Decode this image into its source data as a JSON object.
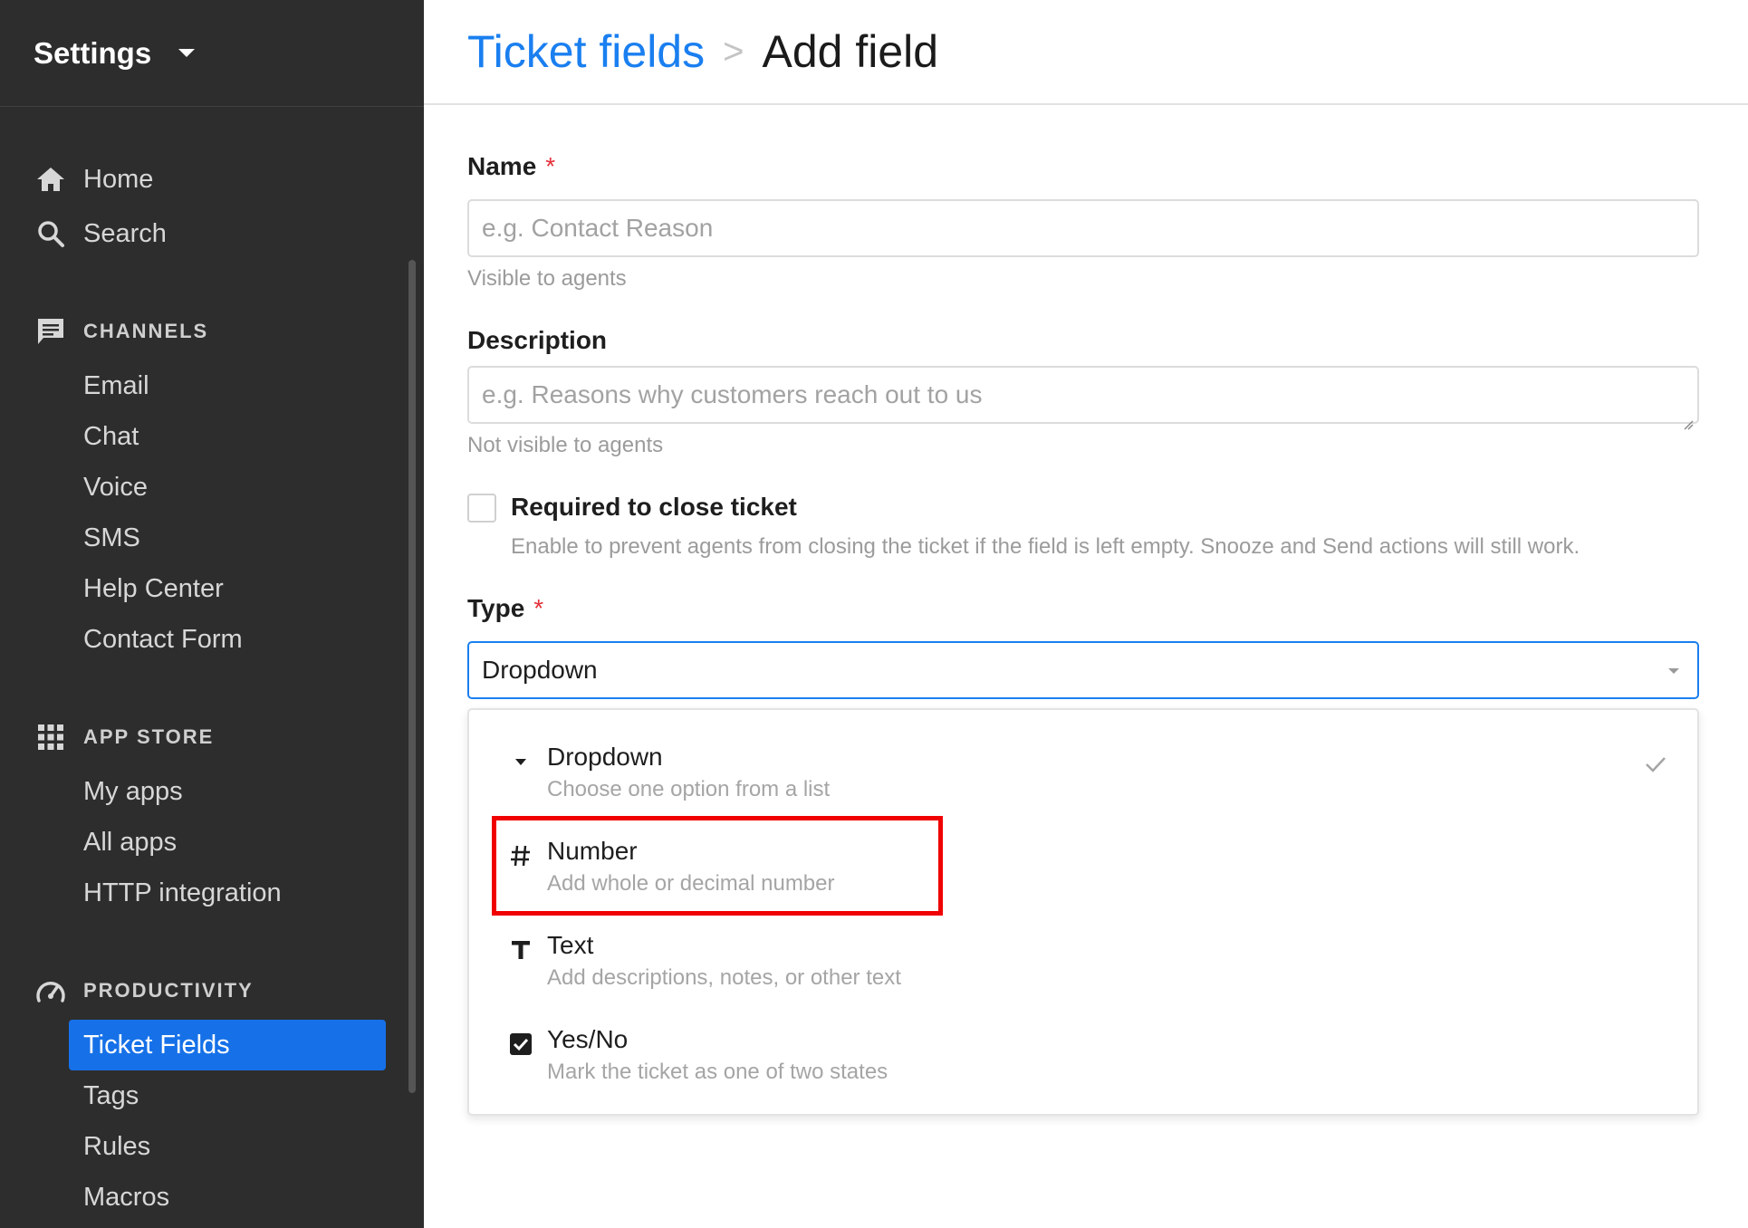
{
  "sidebar": {
    "title": "Settings",
    "top_items": [
      {
        "label": "Home",
        "icon": "home-icon"
      },
      {
        "label": "Search",
        "icon": "search-icon"
      }
    ],
    "sections": [
      {
        "title": "CHANNELS",
        "icon": "chat-bubble-icon",
        "items": [
          "Email",
          "Chat",
          "Voice",
          "SMS",
          "Help Center",
          "Contact Form"
        ]
      },
      {
        "title": "APP STORE",
        "icon": "apps-grid-icon",
        "items": [
          "My apps",
          "All apps",
          "HTTP integration"
        ]
      },
      {
        "title": "PRODUCTIVITY",
        "icon": "speedometer-icon",
        "items": [
          "Ticket Fields",
          "Tags",
          "Rules",
          "Macros"
        ]
      }
    ],
    "active_item": "Ticket Fields"
  },
  "header": {
    "breadcrumb_link": "Ticket fields",
    "separator": ">",
    "current": "Add field"
  },
  "form": {
    "name_label": "Name",
    "required_mark": "*",
    "name_placeholder": "e.g. Contact Reason",
    "name_help": "Visible to agents",
    "description_label": "Description",
    "description_placeholder": "e.g. Reasons why customers reach out to us",
    "description_help": "Not visible to agents",
    "required_checkbox_label": "Required to close ticket",
    "required_checkbox_help": "Enable to prevent agents from closing the ticket if the field is left empty. Snooze and Send actions will still work.",
    "required_checked": false,
    "type_label": "Type",
    "type_value": "Dropdown"
  },
  "type_menu": {
    "options": [
      {
        "title": "Dropdown",
        "desc": "Choose one option from a list",
        "icon": "caret-down-icon",
        "selected": true
      },
      {
        "title": "Number",
        "desc": "Add whole or decimal number",
        "icon": "hash-icon",
        "selected": false
      },
      {
        "title": "Text",
        "desc": "Add descriptions, notes, or other text",
        "icon": "text-t-icon",
        "selected": false
      },
      {
        "title": "Yes/No",
        "desc": "Mark the ticket as one of two states",
        "icon": "checkbox-checked-icon",
        "selected": false
      }
    ]
  },
  "colors": {
    "sidebar_bg": "#2d2d2d",
    "accent": "#1671e8",
    "link": "#1a7ff0",
    "required": "#e5303a",
    "highlight": "#f00000"
  }
}
